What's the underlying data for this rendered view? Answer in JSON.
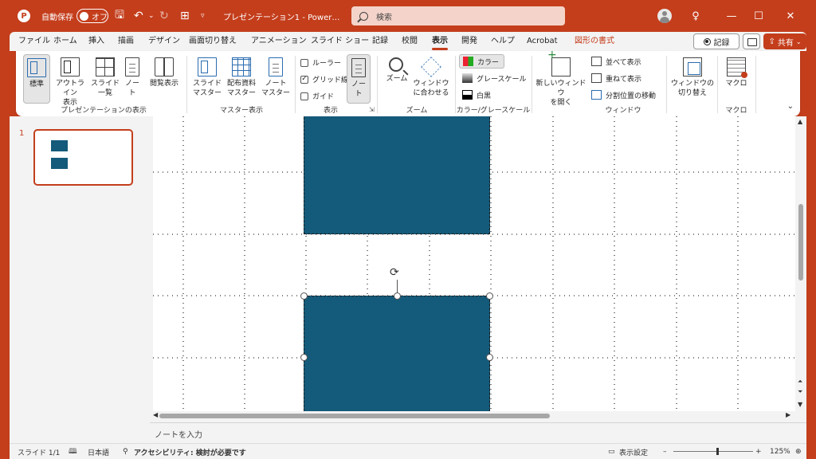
{
  "titlebar": {
    "autosave_label": "自動保存",
    "autosave_state": "オフ",
    "doc_title": "プレゼンテーション1  -  Power…",
    "search_placeholder": "検索"
  },
  "menu": {
    "tabs": [
      "ファイル",
      "ホーム",
      "挿入",
      "描画",
      "デザイン",
      "画面切り替え",
      "アニメーション",
      "スライド ショー",
      "記録",
      "校閲",
      "表示",
      "開発",
      "ヘルプ",
      "Acrobat",
      "図形の書式"
    ],
    "active_tab": "表示",
    "record_label": "記録",
    "share_label": "共有"
  },
  "ribbon": {
    "presentation_views": {
      "label": "プレゼンテーションの表示",
      "normal": "標準",
      "outline": "アウトライン\n表示",
      "sorter": "スライド\n一覧",
      "notes_page": "ノー\nト",
      "reading": "閲覧表示"
    },
    "master_views": {
      "label": "マスター表示",
      "slide_master": "スライド\nマスター",
      "handout_master": "配布資料\nマスター",
      "notes_master": "ノート\nマスター"
    },
    "show": {
      "label": "表示",
      "ruler": "ルーラー",
      "ruler_checked": false,
      "gridlines": "グリッド線",
      "gridlines_checked": true,
      "guides": "ガイド",
      "guides_checked": false,
      "notes": "ノー\nト"
    },
    "zoom": {
      "label": "ズーム",
      "zoom": "ズーム",
      "fit": "ウィンドウ\nに合わせる"
    },
    "color": {
      "label": "カラー/グレースケール",
      "color": "カラー",
      "grayscale": "グレースケール",
      "bw": "白黒"
    },
    "window": {
      "label": "ウィンドウ",
      "new_window": "新しいウィンドウ\nを開く",
      "arrange": "並べて表示",
      "cascade": "重ねて表示",
      "move_split": "分割位置の移動",
      "switch": "ウィンドウの\n切り替え"
    },
    "macro": {
      "label": "マクロ",
      "macro": "マクロ"
    }
  },
  "slides": {
    "number": "1"
  },
  "notes_placeholder": "ノートを入力",
  "statusbar": {
    "slide": "スライド 1/1",
    "language": "日本語",
    "accessibility": "アクセシビリティ: 検討が必要です",
    "display_settings": "表示設定",
    "zoom": "125%"
  },
  "colors": {
    "accent": "#c43e1c",
    "shape_fill": "#145a7a"
  }
}
